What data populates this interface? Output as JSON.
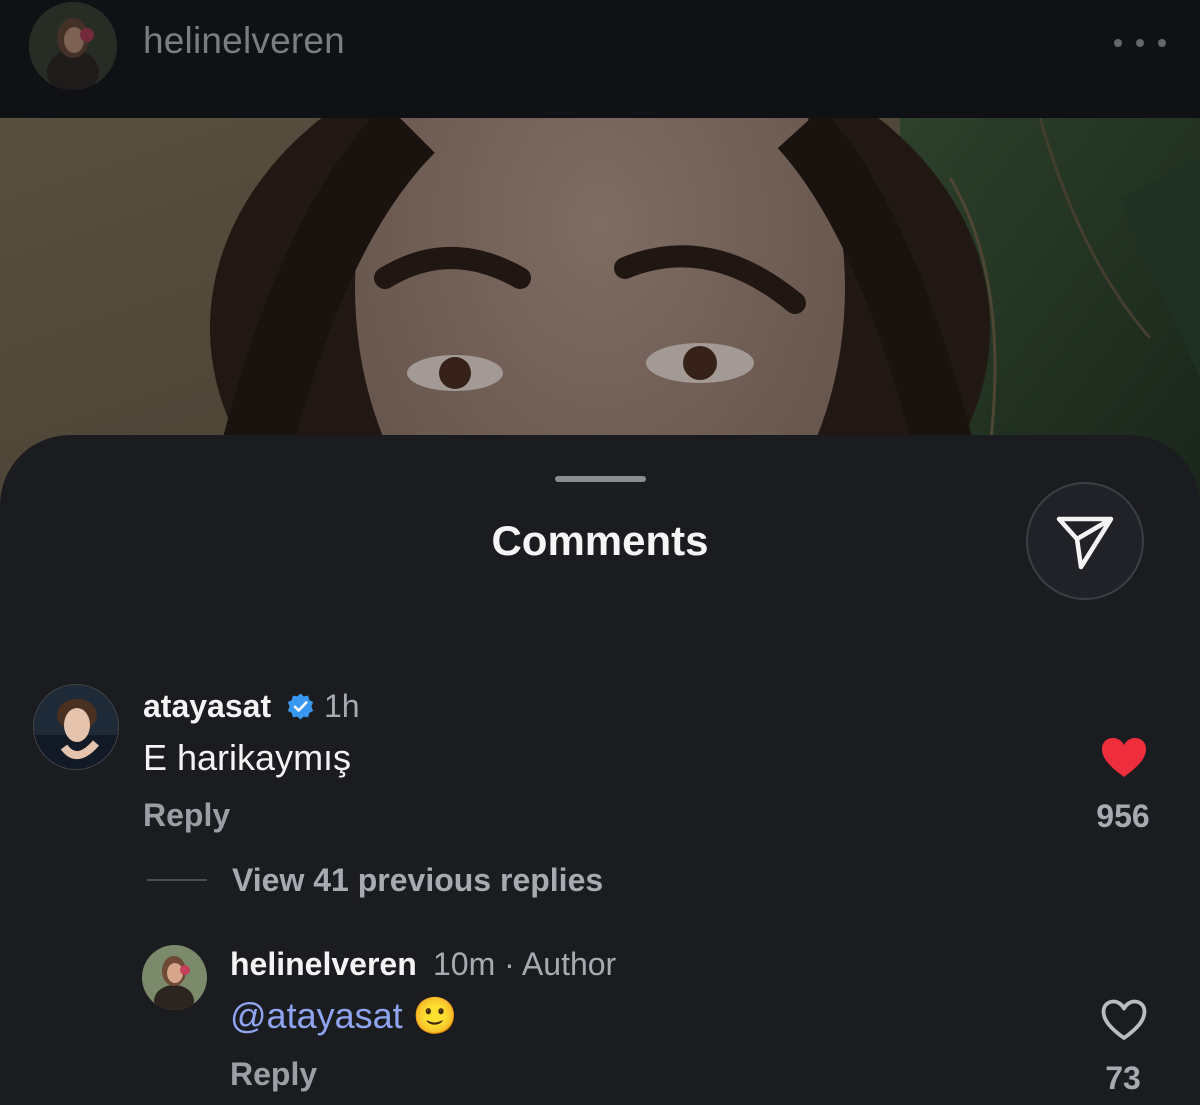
{
  "header": {
    "username": "helinelveren",
    "more_icon": "more-horizontal-icon"
  },
  "comments_sheet": {
    "title": "Comments",
    "share_icon": "send-icon",
    "comment": {
      "username": "atayasat",
      "verified": true,
      "time": "1h",
      "text": "E harikaymış",
      "reply_label": "Reply",
      "likes": "956",
      "liked": true,
      "heart_color": "#ee2e3c"
    },
    "view_replies_label": "View 41 previous replies",
    "reply": {
      "username": "helinelveren",
      "time": "10m",
      "separator": "·",
      "author_badge": "Author",
      "mention": "@atayasat",
      "emoji": "🙂",
      "reply_label": "Reply",
      "likes": "73",
      "liked": false
    }
  },
  "colors": {
    "sheet_background": "#1b1c20",
    "mention": "#8ea4ef",
    "verified": "#3897f0"
  }
}
